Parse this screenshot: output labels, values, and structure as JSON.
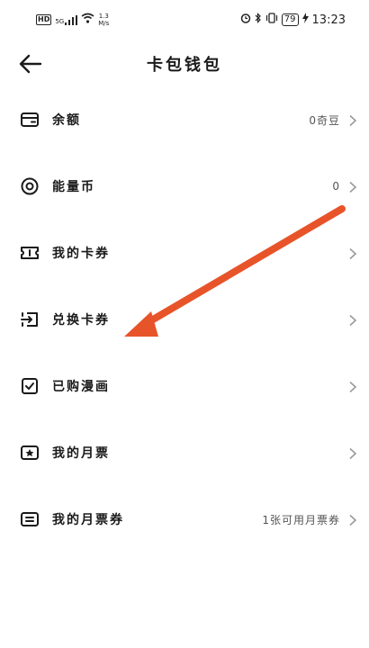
{
  "status_bar": {
    "hd": "HD",
    "signal": "5G",
    "speed_value": "1.3",
    "speed_unit": "M/s",
    "battery": "79",
    "time": "13:23"
  },
  "header": {
    "title": "卡包钱包"
  },
  "menu": [
    {
      "label": "余额",
      "value": "0奇豆",
      "icon": "wallet-icon"
    },
    {
      "label": "能量币",
      "value": "0",
      "icon": "coin-icon"
    },
    {
      "label": "我的卡券",
      "value": "",
      "icon": "ticket-icon"
    },
    {
      "label": "兑换卡券",
      "value": "",
      "icon": "exchange-icon"
    },
    {
      "label": "已购漫画",
      "value": "",
      "icon": "comic-icon"
    },
    {
      "label": "我的月票",
      "value": "",
      "icon": "monthly-ticket-icon"
    },
    {
      "label": "我的月票券",
      "value": "1张可用月票券",
      "icon": "monthly-voucher-icon"
    }
  ],
  "colors": {
    "annotation_arrow": "#e8542a",
    "chevron": "#9a9a9a",
    "icon": "#1a1a1a"
  }
}
